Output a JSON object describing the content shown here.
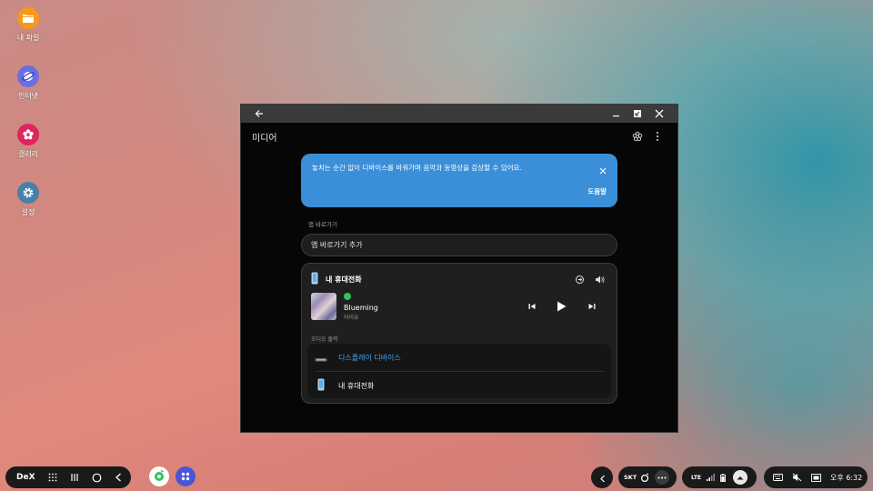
{
  "desktop": {
    "icons": [
      {
        "label": "내 파일",
        "icon": "folder-icon",
        "color": "#f79a1b"
      },
      {
        "label": "인터넷",
        "icon": "internet-icon",
        "color": "#6a6fe0"
      },
      {
        "label": "갤러리",
        "icon": "gallery-flower-icon",
        "color": "#e0245e"
      },
      {
        "label": "설정",
        "icon": "gear-icon",
        "color": "#4a7fa8"
      }
    ]
  },
  "window": {
    "app_title": "미디어",
    "banner": {
      "message": "놓치는 순간 없이 디바이스를 바꿔가며 음악과 동영상을 감상할 수 있어요.",
      "help": "도움말"
    },
    "shortcuts_section": "앱 바로가기",
    "add_shortcut": "앱 바로가기 추가",
    "player": {
      "device": "내 휴대전화",
      "song_title": "Blueming",
      "artist": "아이유",
      "audio_output_label": "오디오 출력",
      "outputs": [
        {
          "name": "디스플레이 디바이스",
          "selected": true
        },
        {
          "name": "내 휴대전화",
          "selected": false
        }
      ]
    }
  },
  "taskbar": {
    "dex_label": "DeX",
    "carrier": "SKT",
    "network": "LTE",
    "clock": "오후 6:32"
  },
  "colors": {
    "accent": "#3a8fd8",
    "selected_output": "#4aa3f0"
  }
}
